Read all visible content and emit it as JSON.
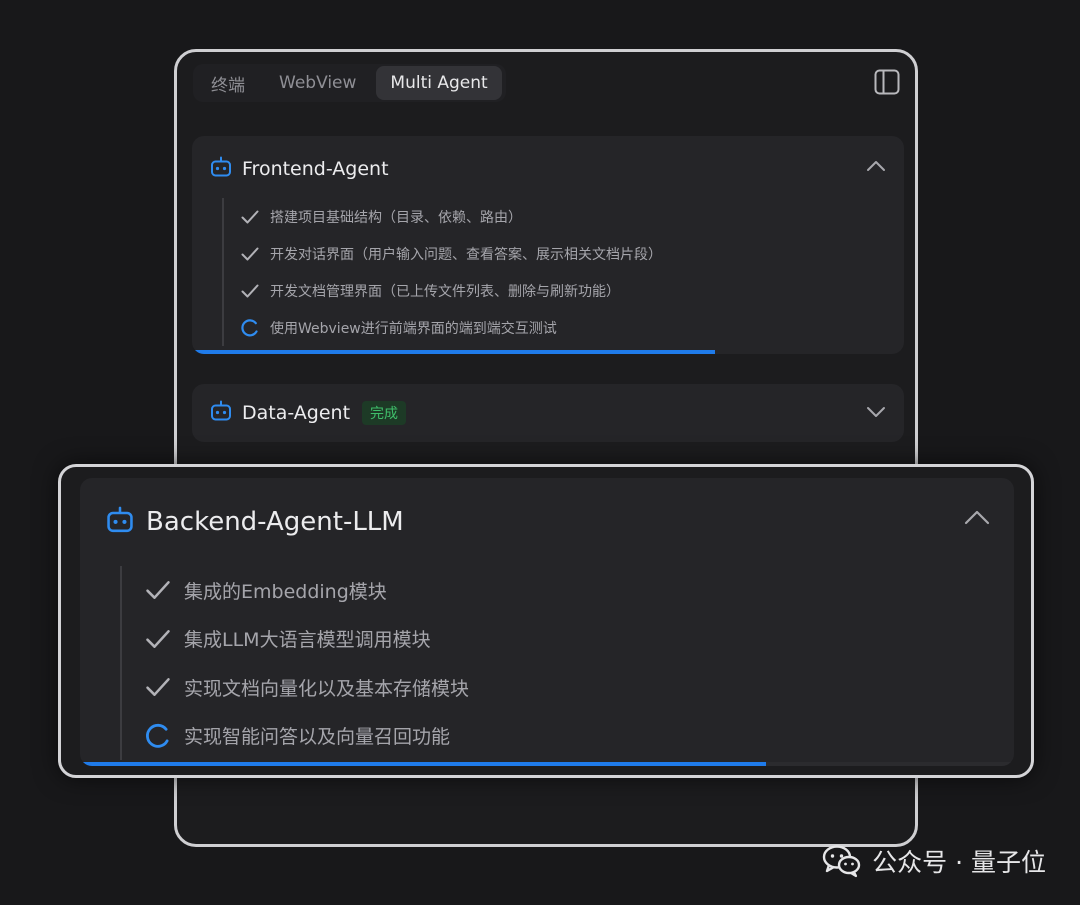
{
  "tabs": [
    {
      "label": "终端",
      "active": false
    },
    {
      "label": "WebView",
      "active": false
    },
    {
      "label": "Multi Agent",
      "active": true
    }
  ],
  "icons": {
    "panel_toggle": "sidebar-panel-icon",
    "agent": "robot-icon",
    "done": "check-icon",
    "running": "loading-spinner-icon",
    "collapse": "chevron-up-icon",
    "expand": "chevron-down-icon",
    "watermark": "wechat-icon"
  },
  "colors": {
    "accent": "#1f7bea",
    "success": "#3fbe6a"
  },
  "agents": [
    {
      "title": "Frontend-Agent",
      "expanded": true,
      "progress_fraction": 0.735,
      "tasks": [
        {
          "text": "搭建项目基础结构（目录、依赖、路由）",
          "status": "done"
        },
        {
          "text": "开发对话界面（用户输入问题、查看答案、展示相关文档片段）",
          "status": "done"
        },
        {
          "text": "开发文档管理界面（已上传文件列表、删除与刷新功能）",
          "status": "done"
        },
        {
          "text": "使用Webview进行前端界面的端到端交互测试",
          "status": "running"
        }
      ]
    },
    {
      "title": "Data-Agent",
      "badge": "完成",
      "expanded": false
    },
    {
      "title": "Backend-Agent-LLM",
      "expanded": true,
      "progress_fraction": 0.735,
      "tasks": [
        {
          "text": "集成的Embedding模块",
          "status": "done"
        },
        {
          "text": "集成LLM大语言模型调用模块",
          "status": "done"
        },
        {
          "text": "实现文档向量化以及基本存储模块",
          "status": "done"
        },
        {
          "text": "实现智能问答以及向量召回功能",
          "status": "running"
        }
      ]
    }
  ],
  "watermark": {
    "text": "公众号 · 量子位"
  }
}
